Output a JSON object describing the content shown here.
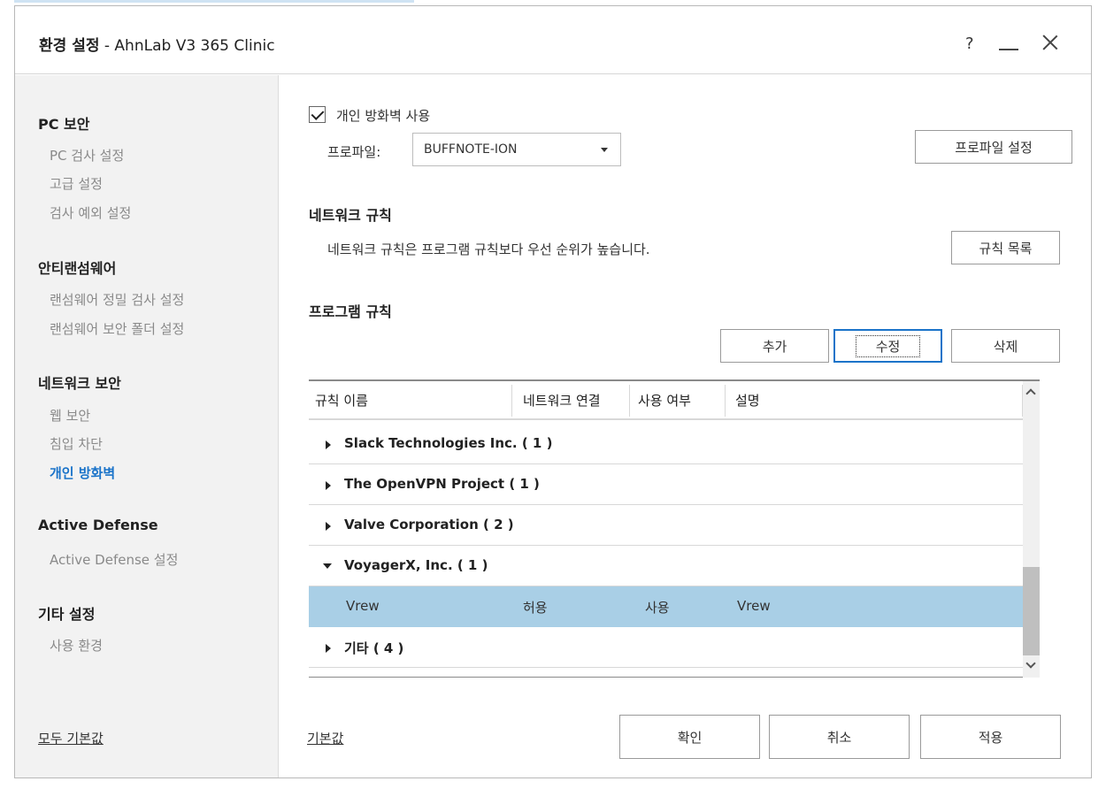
{
  "window": {
    "title_bold": "환경 설정",
    "title_rest": " - AhnLab V3 365 Clinic",
    "help": "?"
  },
  "sidebar": {
    "sections": [
      {
        "title": "PC 보안",
        "items": [
          "PC 검사 설정",
          "고급 설정",
          "검사 예외 설정"
        ]
      },
      {
        "title": "안티랜섬웨어",
        "items": [
          "랜섬웨어 정밀 검사 설정",
          "랜섬웨어 보안 폴더 설정"
        ]
      },
      {
        "title": "네트워크 보안",
        "items": [
          "웹 보안",
          "침입 차단",
          "개인 방화벽"
        ]
      },
      {
        "title": "Active Defense",
        "items": [
          "Active Defense 설정"
        ]
      },
      {
        "title": "기타 설정",
        "items": [
          "사용 환경"
        ]
      }
    ],
    "active_item": "개인 방화벽",
    "reset_all": "모두 기본값"
  },
  "firewall": {
    "enable_label": "개인 방화벽 사용",
    "enabled": true,
    "profile_label": "프로파일:",
    "profile_value": "BUFFNOTE-ION",
    "profile_settings_button": "프로파일 설정"
  },
  "network_rules": {
    "title": "네트워크 규칙",
    "description": "네트워크 규칙은 프로그램 규칙보다 우선 순위가 높습니다.",
    "rule_list_button": "규칙 목록"
  },
  "program_rules": {
    "title": "프로그램 규칙",
    "add_button": "추가",
    "edit_button": "수정",
    "delete_button": "삭제",
    "columns": [
      "규칙 이름",
      "네트워크 연결",
      "사용 여부",
      "설명"
    ],
    "groups": [
      {
        "label": "Slack Technologies Inc. ( 1 )",
        "expanded": false
      },
      {
        "label": "The OpenVPN Project ( 1 )",
        "expanded": false
      },
      {
        "label": "Valve Corporation ( 2 )",
        "expanded": false
      },
      {
        "label": "VoyagerX, Inc. ( 1 )",
        "expanded": true
      },
      {
        "label": "기타 ( 4 )",
        "expanded": false
      }
    ],
    "selected_row": {
      "name": "Vrew",
      "network": "허용",
      "usage": "사용",
      "description": "Vrew"
    }
  },
  "footer": {
    "default_link": "기본값",
    "ok_button": "확인",
    "cancel_button": "취소",
    "apply_button": "적용"
  },
  "colors": {
    "accent": "#1a73c9",
    "selected_row": "#a9cfe6",
    "sidebar_bg": "#f2f2f2"
  }
}
